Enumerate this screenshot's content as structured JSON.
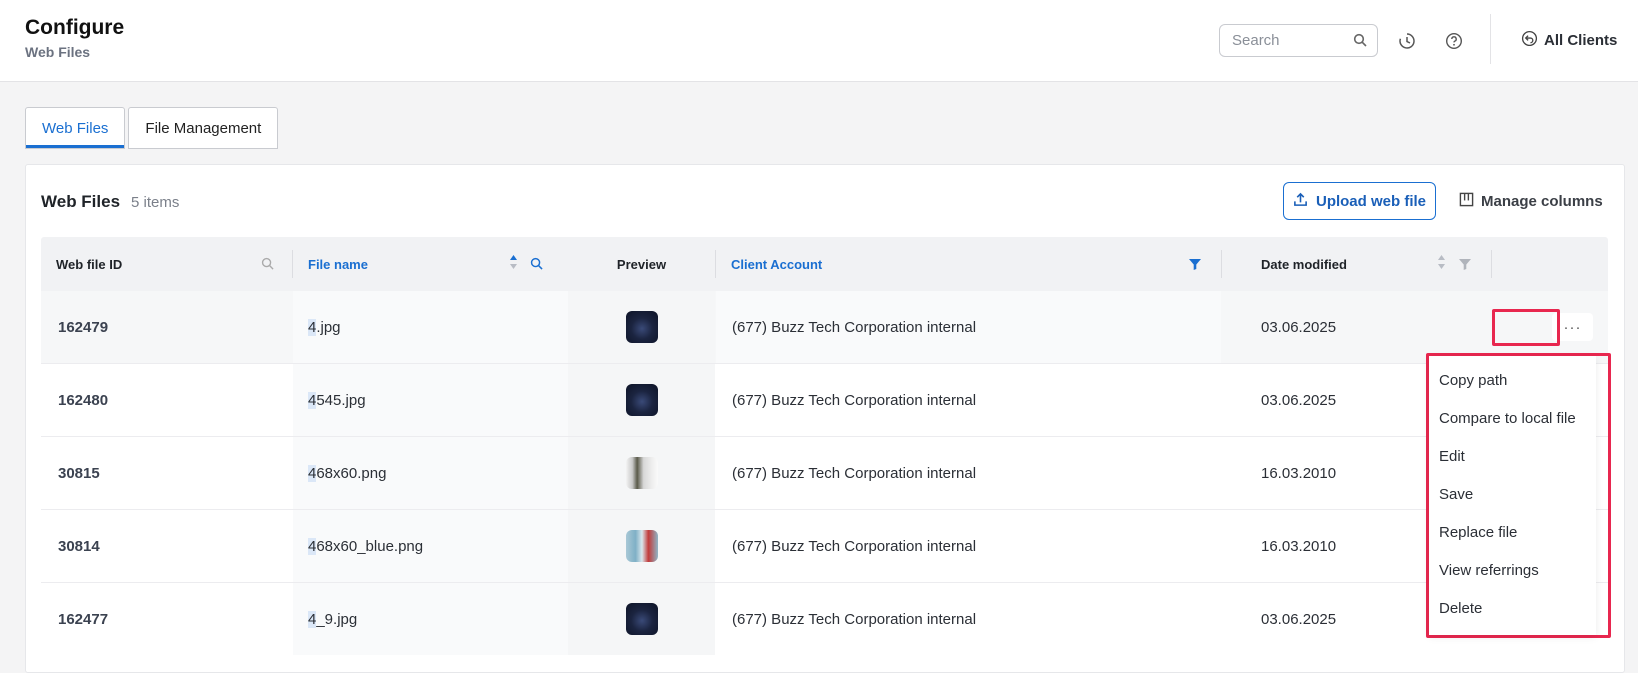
{
  "header": {
    "title": "Configure",
    "subtitle": "Web Files",
    "search_placeholder": "Search",
    "all_clients_label": "All Clients"
  },
  "tabs": [
    {
      "label": "Web Files",
      "active": true
    },
    {
      "label": "File Management",
      "active": false
    }
  ],
  "panel": {
    "title": "Web Files",
    "count": "5 items",
    "upload_label": "Upload web file",
    "manage_columns_label": "Manage columns"
  },
  "table": {
    "columns": [
      "Web file ID",
      "File name",
      "Preview",
      "Client Account",
      "Date modified"
    ],
    "rows": [
      {
        "id": "162479",
        "name_hl": "4",
        "name_rest": ".jpg",
        "thumb": "dark",
        "client": "(677) Buzz Tech Corporation internal",
        "date": "03.06.2025"
      },
      {
        "id": "162480",
        "name_hl": "4",
        "name_rest": "545.jpg",
        "thumb": "dark",
        "client": "(677) Buzz Tech Corporation internal",
        "date": "03.06.2025"
      },
      {
        "id": "30815",
        "name_hl": "4",
        "name_rest": "68x60.png",
        "thumb": "gray",
        "client": "(677) Buzz Tech Corporation internal",
        "date": "16.03.2010"
      },
      {
        "id": "30814",
        "name_hl": "4",
        "name_rest": "68x60_blue.png",
        "thumb": "blue",
        "client": "(677) Buzz Tech Corporation internal",
        "date": "16.03.2010"
      },
      {
        "id": "162477",
        "name_hl": "4",
        "name_rest": "_9.jpg",
        "thumb": "dark",
        "client": "(677) Buzz Tech Corporation internal",
        "date": "03.06.2025"
      }
    ],
    "more_label": "···"
  },
  "context_menu": {
    "items": [
      "Copy path",
      "Compare to local file",
      "Edit",
      "Save",
      "Replace file",
      "View referrings",
      "Delete"
    ]
  },
  "colors": {
    "accent": "#1a6fd1",
    "highlight_outline": "#e8274f"
  }
}
